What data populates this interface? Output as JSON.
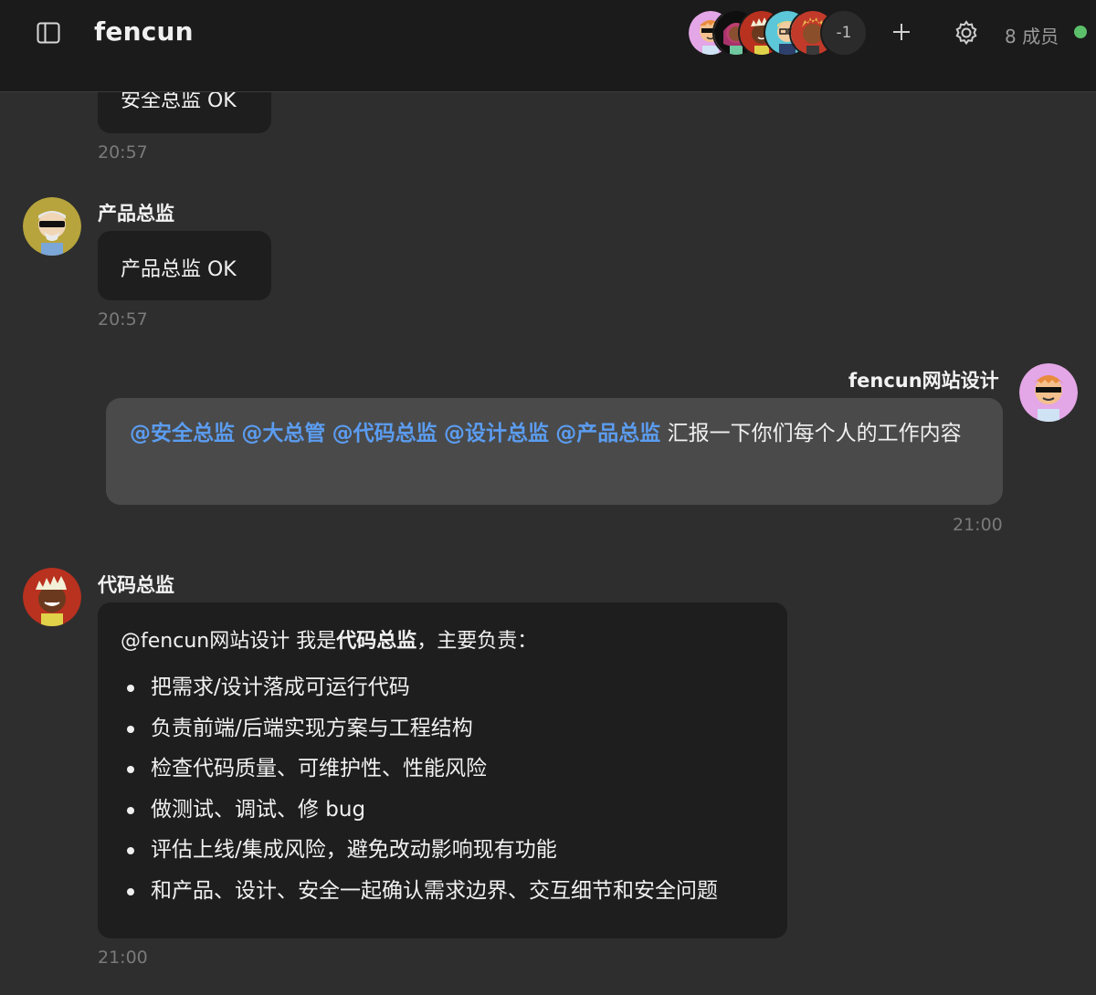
{
  "header": {
    "title": "fencun",
    "overflow_count": "-1",
    "members": "8 成员",
    "online_color": "#5cbf6a"
  },
  "icons": [
    "sidebar-toggle-icon",
    "plus-icon",
    "gear-icon"
  ],
  "messages": [
    {
      "text": "安全总监 OK",
      "time": "20:57"
    },
    {
      "sender": "产品总监",
      "text": "产品总监 OK",
      "time": "20:57"
    },
    {
      "sender": "fencun网站设计",
      "mentions": [
        "@安全总监",
        "@大总管",
        "@代码总监",
        "@设计总监",
        "@产品总监"
      ],
      "text": "汇报一下你们每个人的工作内容",
      "time": "21:00"
    },
    {
      "sender": "代码总监",
      "intro_mention": "@fencun网站设计",
      "intro_pre": " 我是",
      "intro_bold": "代码总监",
      "intro_post": "，主要负责：",
      "bullets": [
        "把需求/设计落成可运行代码",
        "负责前端/后端实现方案与工程结构",
        "检查代码质量、可维护性、性能风险",
        "做测试、调试、修 bug",
        "评估上线/集成风险，避免改动影响现有功能",
        "和产品、设计、安全一起确认需求边界、交互细节和安全问题"
      ],
      "time": "21:00"
    }
  ],
  "colors": {
    "accent_mention": "#5b9cf0",
    "background": "#2e2e2e",
    "header": "#1b1b1b"
  }
}
